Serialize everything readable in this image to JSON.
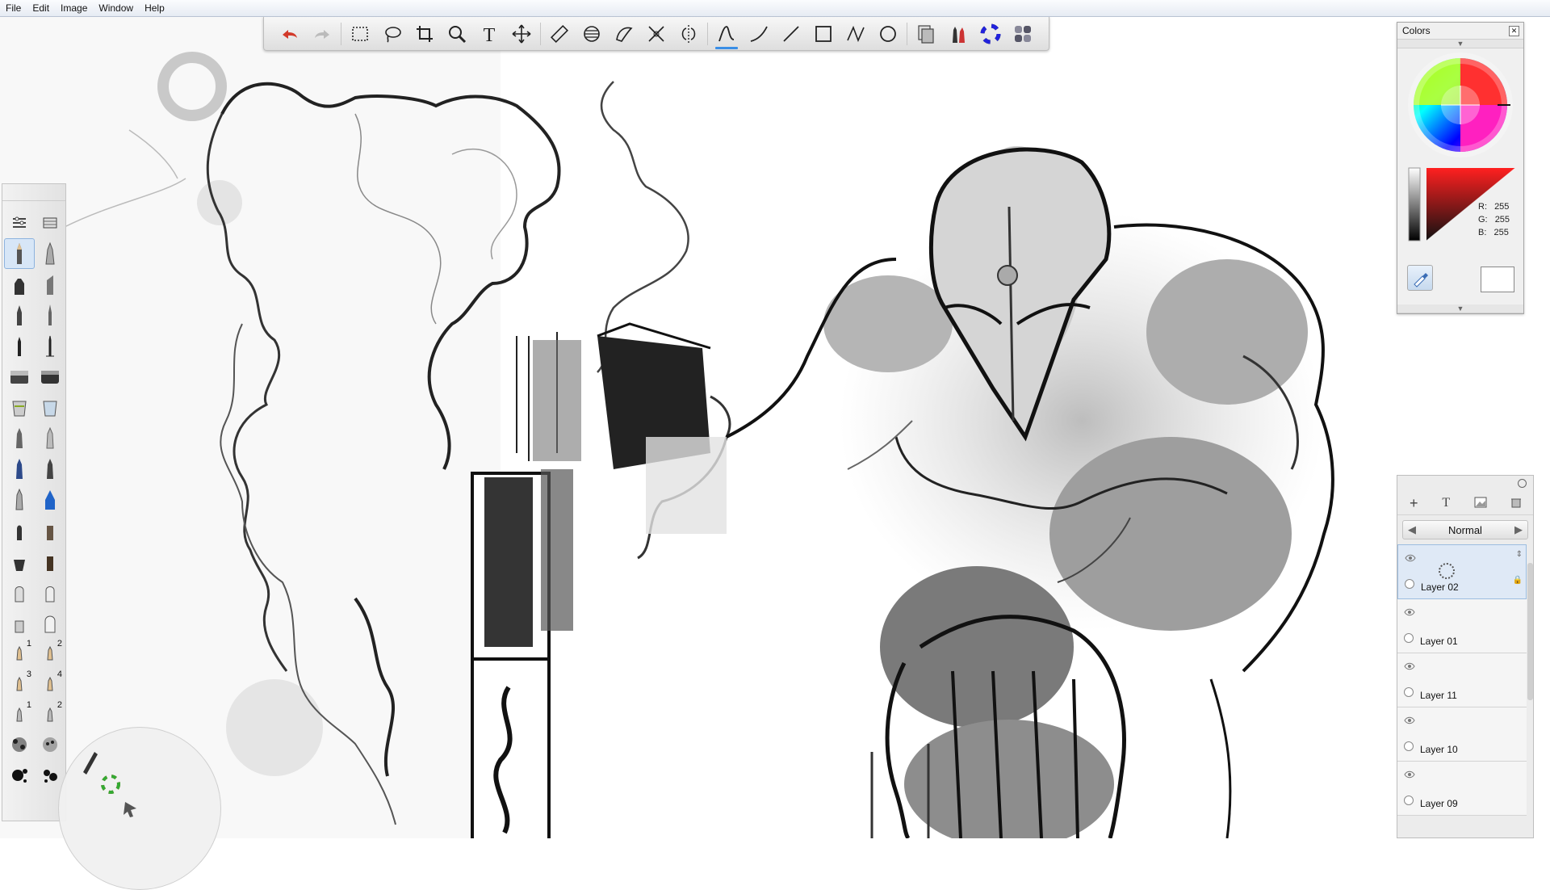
{
  "menu": {
    "items": [
      "File",
      "Edit",
      "Image",
      "Window",
      "Help"
    ]
  },
  "toolbar": {
    "tools": [
      "undo-icon",
      "redo-icon",
      "rect-select-icon",
      "lasso-icon",
      "crop-icon",
      "zoom-icon",
      "text-icon",
      "move-icon",
      "ruler-icon",
      "ellipse-guide-icon",
      "french-curve-icon",
      "symmetry-icon",
      "symmetry-mirror-icon",
      "stroke-icon",
      "curve-icon",
      "line-icon",
      "rectangle-icon",
      "polyline-icon",
      "ellipse-icon",
      "copy-paste-icon",
      "brush-set-icon",
      "color-wheel-icon",
      "palette-icon"
    ],
    "active": "stroke-icon"
  },
  "colors_panel": {
    "title": "Colors",
    "r_label": "R:",
    "r_value": "255",
    "g_label": "G:",
    "g_value": "255",
    "b_label": "B:",
    "b_value": "255",
    "current_color": "#ffffff"
  },
  "layers_panel": {
    "blend_mode": "Normal",
    "layers": [
      {
        "name": "Layer 02",
        "selected": true
      },
      {
        "name": "Layer 01",
        "selected": false
      },
      {
        "name": "Layer 11",
        "selected": false
      },
      {
        "name": "Layer 10",
        "selected": false
      },
      {
        "name": "Layer 09",
        "selected": false
      }
    ]
  },
  "toolbox": {
    "numbers": [
      "1",
      "2",
      "3",
      "4",
      "1",
      "2"
    ]
  },
  "accent": "#3a8ee6"
}
